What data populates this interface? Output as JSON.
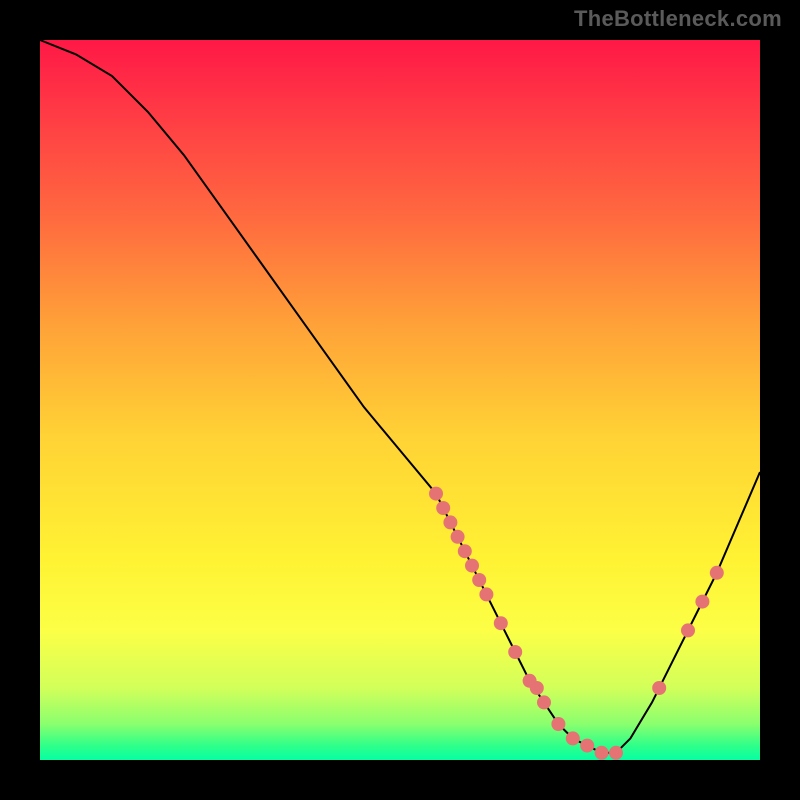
{
  "attribution": "TheBottleneck.com",
  "colors": {
    "background": "#000000",
    "curve": "#000000",
    "marker": "#e57373",
    "gradient_top": "#ff1846",
    "gradient_mid": "#ffd235",
    "gradient_bottom": "#06ffa3"
  },
  "chart_data": {
    "type": "line",
    "title": "",
    "xlabel": "",
    "ylabel": "",
    "xlim": [
      0,
      100
    ],
    "ylim": [
      0,
      100
    ],
    "grid": false,
    "legend": false,
    "x": [
      0,
      5,
      10,
      15,
      20,
      25,
      30,
      35,
      40,
      45,
      50,
      55,
      56,
      58,
      60,
      62,
      64,
      66,
      68,
      70,
      72,
      74,
      76,
      78,
      80,
      82,
      85,
      88,
      91,
      94,
      97,
      100
    ],
    "y_value": [
      100,
      98,
      95,
      90,
      84,
      77,
      70,
      63,
      56,
      49,
      43,
      37,
      35,
      31,
      27,
      23,
      19,
      15,
      11,
      8,
      5,
      3,
      2,
      1,
      1,
      3,
      8,
      14,
      20,
      26,
      33,
      40
    ],
    "markers": {
      "x": [
        55,
        56,
        57,
        58,
        59,
        60,
        61,
        62,
        64,
        66,
        68,
        69,
        70,
        72,
        74,
        76,
        78,
        80,
        86,
        90,
        92,
        94
      ],
      "y_value": [
        37,
        35,
        33,
        31,
        29,
        27,
        25,
        23,
        19,
        15,
        11,
        10,
        8,
        5,
        3,
        2,
        1,
        1,
        10,
        18,
        22,
        26
      ]
    }
  }
}
